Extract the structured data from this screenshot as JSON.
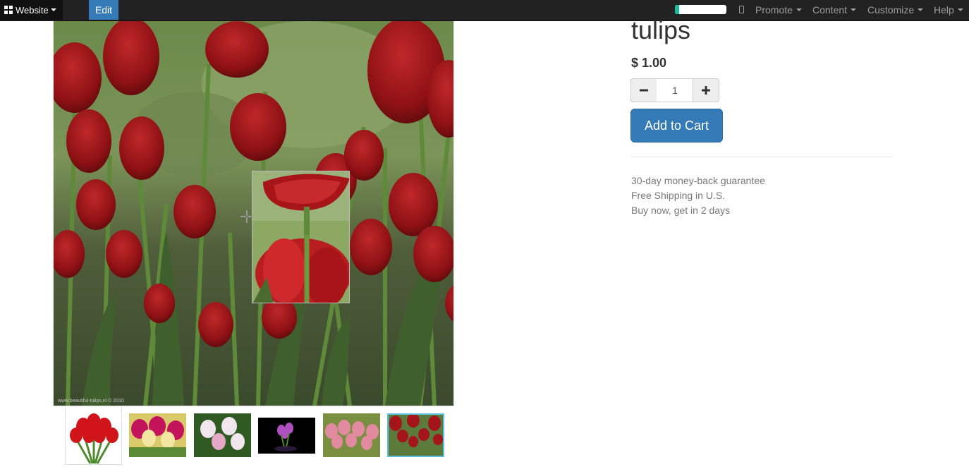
{
  "topbar": {
    "app_label": "Website",
    "edit_label": "Edit",
    "progress_fraction": 0.08,
    "menus": [
      "Promote",
      "Content",
      "Customize",
      "Help"
    ]
  },
  "product": {
    "title": "tulips",
    "price": "$ 1.00",
    "quantity": "1",
    "add_to_cart_label": "Add to Cart",
    "benefits": [
      "30-day money-back guarantee",
      "Free Shipping in U.S.",
      "Buy now, get in 2 days"
    ]
  },
  "gallery": {
    "image_watermark": "www.beautiful-tulips.nl © 2010",
    "thumbnail_count": 6,
    "active_thumbnail": 6
  },
  "colors": {
    "topbar_bg": "#222222",
    "accent": "#337ab7",
    "progress": "#1abc9c",
    "active_thumb_border": "#5bc0de"
  }
}
